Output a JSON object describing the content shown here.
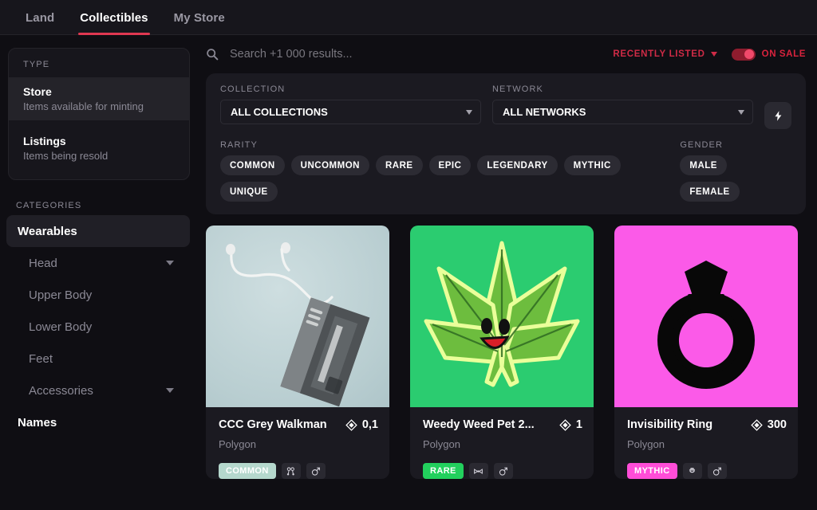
{
  "nav": {
    "tabs": [
      {
        "label": "Land",
        "active": false
      },
      {
        "label": "Collectibles",
        "active": true
      },
      {
        "label": "My Store",
        "active": false
      }
    ],
    "active_underline_color": "#e03851"
  },
  "sidebar": {
    "type_label": "TYPE",
    "type_items": [
      {
        "title": "Store",
        "subtitle": "Items available for minting",
        "selected": true
      },
      {
        "title": "Listings",
        "subtitle": "Items being resold",
        "selected": false
      }
    ],
    "categories_label": "CATEGORIES",
    "categories": [
      {
        "label": "Wearables",
        "level": "top",
        "selected": true,
        "chevron": false
      },
      {
        "label": "Head",
        "level": "sub",
        "selected": false,
        "chevron": true
      },
      {
        "label": "Upper Body",
        "level": "sub",
        "selected": false,
        "chevron": false
      },
      {
        "label": "Lower Body",
        "level": "sub",
        "selected": false,
        "chevron": false
      },
      {
        "label": "Feet",
        "level": "sub",
        "selected": false,
        "chevron": false
      },
      {
        "label": "Accessories",
        "level": "sub",
        "selected": false,
        "chevron": true
      },
      {
        "label": "Names",
        "level": "top",
        "selected": false,
        "chevron": false
      }
    ]
  },
  "search": {
    "placeholder": "Search +1 000 results...",
    "value": "",
    "icon": "search-icon"
  },
  "sort": {
    "label": "RECENTLY LISTED",
    "icon": "chevron-down-icon",
    "color": "#cf2b46"
  },
  "on_sale": {
    "label": "ON SALE",
    "enabled": true,
    "color": "#d9233d"
  },
  "filters": {
    "collection": {
      "label": "COLLECTION",
      "selected": "ALL COLLECTIONS",
      "options": [
        "ALL COLLECTIONS"
      ]
    },
    "network": {
      "label": "NETWORK",
      "selected": "ALL NETWORKS",
      "options": [
        "ALL NETWORKS"
      ]
    },
    "bolt_button": {
      "icon": "lightning-bolt-icon"
    },
    "rarity": {
      "label": "RARITY",
      "options": [
        "COMMON",
        "UNCOMMON",
        "RARE",
        "EPIC",
        "LEGENDARY",
        "MYTHIC",
        "UNIQUE"
      ]
    },
    "gender": {
      "label": "GENDER",
      "options": [
        "MALE",
        "FEMALE"
      ]
    }
  },
  "cards": [
    {
      "title": "CCC Grey Walkman",
      "price": "0,1",
      "price_icon": "mana-diamond-icon",
      "network": "Polygon",
      "rarity": "COMMON",
      "rarity_color": "#b5d8cd",
      "rarity_text_color": "#ffffff",
      "thumb_name": "walkman-with-earbuds-image",
      "thumb_bg": "#c3d7d8",
      "icons": [
        "earring-icon",
        "gender-icon"
      ]
    },
    {
      "title": "Weedy Weed Pet 2...",
      "price": "1",
      "price_icon": "mana-diamond-icon",
      "network": "Polygon",
      "rarity": "RARE",
      "rarity_color": "#22d05d",
      "rarity_text_color": "#ffffff",
      "thumb_name": "smiling-cannabis-leaf-image",
      "thumb_bg": "#2bcc70",
      "icons": [
        "bowtie-icon",
        "gender-icon"
      ]
    },
    {
      "title": "Invisibility Ring",
      "price": "300",
      "price_icon": "mana-diamond-icon",
      "network": "Polygon",
      "rarity": "MYTHIC",
      "rarity_color": "#ff4dd8",
      "rarity_text_color": "#ffffff",
      "thumb_name": "diamond-ring-silhouette-image",
      "thumb_bg": "#fb5ae8",
      "icons": [
        "ring-icon",
        "gender-icon"
      ]
    }
  ]
}
